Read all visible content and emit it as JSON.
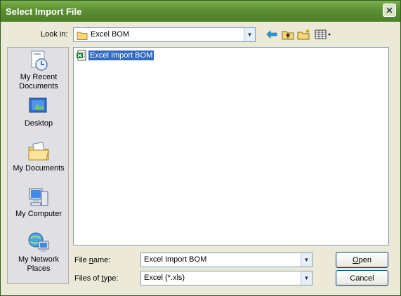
{
  "window": {
    "title": "Select Import File"
  },
  "toolbar": {
    "look_in_label": "Look in:",
    "look_in_value": "Excel BOM"
  },
  "places": [
    {
      "label_line1": "My Recent",
      "label_line2": "Documents",
      "icon": "recent-documents-icon"
    },
    {
      "label_line1": "Desktop",
      "label_line2": "",
      "icon": "desktop-icon"
    },
    {
      "label_line1": "My Documents",
      "label_line2": "",
      "icon": "my-documents-icon"
    },
    {
      "label_line1": "My Computer",
      "label_line2": "",
      "icon": "my-computer-icon"
    },
    {
      "label_line1": "My Network",
      "label_line2": "Places",
      "icon": "network-places-icon"
    }
  ],
  "files": [
    {
      "name": "Excel Import BOM",
      "icon": "excel-file-icon",
      "selected": true
    }
  ],
  "form": {
    "file_name_label": "File name:",
    "file_name_value": "Excel Import BOM",
    "file_type_label": "Files of type:",
    "file_type_value": "Excel (*.xls)"
  },
  "buttons": {
    "open": "Open",
    "cancel": "Cancel"
  },
  "colors": {
    "titlebar": "#5C8F33",
    "selection": "#316AC5",
    "dialog_bg": "#ECE9D8"
  }
}
